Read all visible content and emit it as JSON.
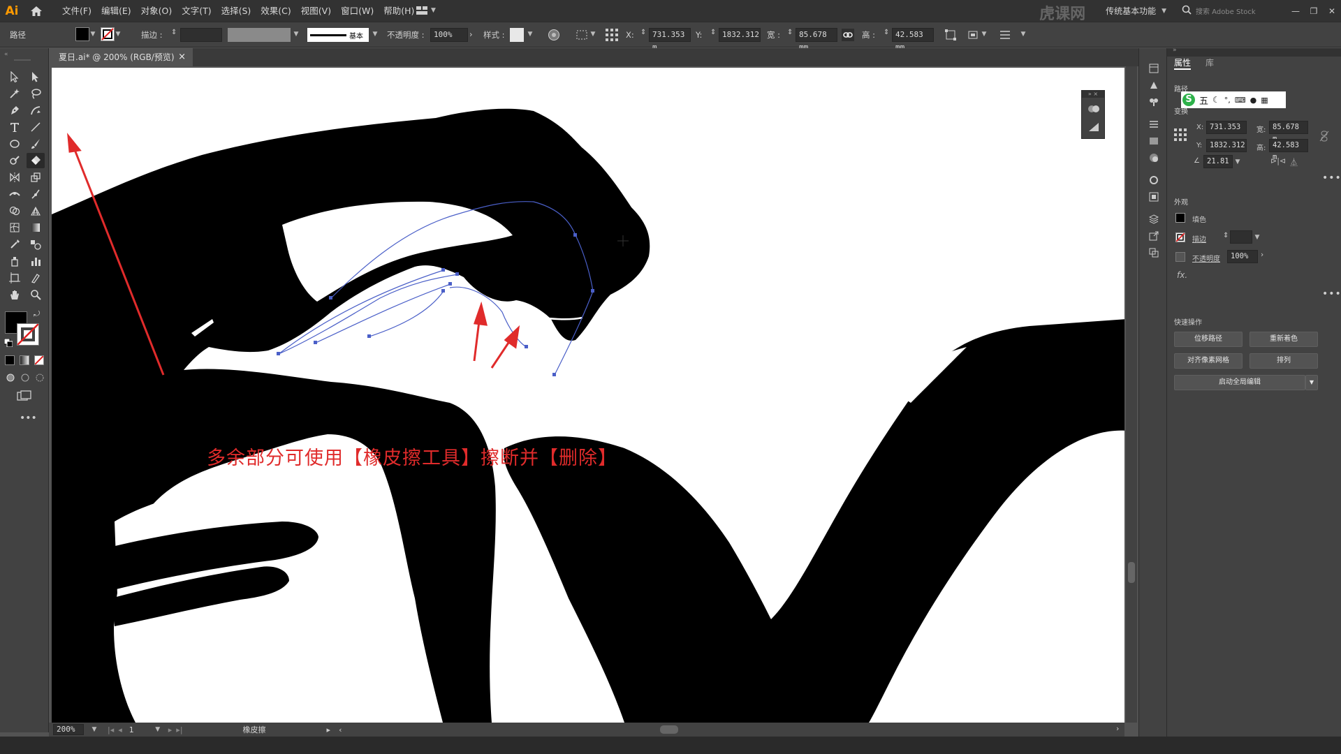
{
  "app": {
    "logo": "Ai",
    "menus": [
      "文件(F)",
      "编辑(E)",
      "对象(O)",
      "文字(T)",
      "选择(S)",
      "效果(C)",
      "视图(V)",
      "窗口(W)",
      "帮助(H)"
    ],
    "workspace": "传统基本功能",
    "stock_search_placeholder": "搜索 Adobe Stock",
    "watermark": "虎课网"
  },
  "control_bar": {
    "selection_type": "路径",
    "stroke_label": "描边 :",
    "stroke_profile": "基本",
    "opacity_label": "不透明度 :",
    "opacity_value": "100%",
    "style_label": "样式 :",
    "x_label": "X:",
    "x_value": "731.353 m",
    "y_label": "Y:",
    "y_value": "1832.312",
    "w_label": "宽 :",
    "w_value": "85.678 mm",
    "h_label": "高 :",
    "h_value": "42.583 mm",
    "fill_color": "#000000"
  },
  "document": {
    "tab_title": "夏日.ai* @ 200% (RGB/预览)",
    "close_glyph": "×"
  },
  "annotation": {
    "text": "多余部分可使用【橡皮擦工具】擦断并【删除】",
    "color": "#e02b2b"
  },
  "status_bar": {
    "zoom": "200%",
    "artboard_number": "1",
    "current_tool": "橡皮擦"
  },
  "properties_panel": {
    "tab_properties": "属性",
    "tab_libraries": "库",
    "section_path": "路径",
    "section_transform": "变换",
    "x_label": "X:",
    "x_value": "731.353",
    "y_label": "Y:",
    "y_value": "1832.312",
    "w_label": "宽:",
    "w_value": "85.678 m",
    "h_label": "高:",
    "h_value": "42.583 m",
    "angle_value": "21.81",
    "section_appearance": "外观",
    "fill_label": "填色",
    "stroke_label": "描边",
    "opacity_label": "不透明度",
    "opacity_value": "100%",
    "fx_label": "fx.",
    "section_quick_actions": "快速操作",
    "btn_offset_path": "位移路径",
    "btn_recolor": "重新着色",
    "btn_align_pixel": "对齐像素网格",
    "btn_arrange": "排列",
    "btn_global_edit": "启动全局编辑",
    "ime_label": "五"
  },
  "colors": {
    "menubar": "#323232",
    "panel": "#424242",
    "canvas_bg": "#535353",
    "accent_logo": "#ff9a00",
    "path_selection": "#4a5fc8"
  }
}
